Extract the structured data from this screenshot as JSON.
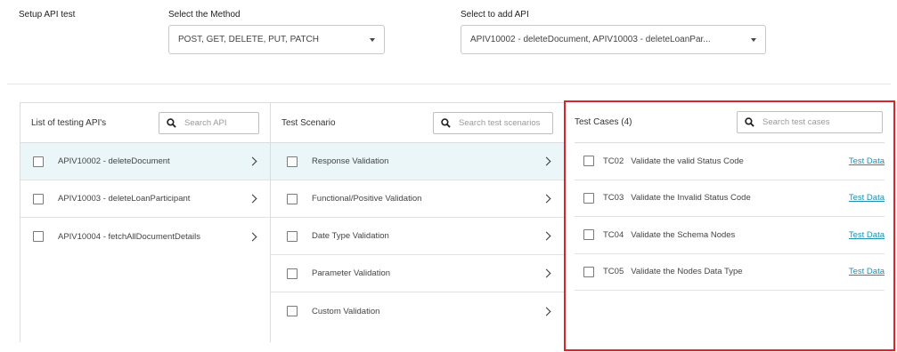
{
  "setup": {
    "title": "Setup API test",
    "method_label": "Select the Method",
    "method_value": "POST, GET, DELETE, PUT, PATCH",
    "api_label": "Select to add API",
    "api_value": "APIV10002 - deleteDocument, APIV10003 - deleteLoanPar..."
  },
  "apis_panel": {
    "title": "List of testing API's",
    "search_placeholder": "Search API",
    "items": [
      {
        "label": "APIV10002 - deleteDocument"
      },
      {
        "label": "APIV10003 - deleteLoanParticipant"
      },
      {
        "label": "APIV10004 - fetchAllDocumentDetails"
      }
    ]
  },
  "scenarios_panel": {
    "title": "Test Scenario",
    "search_placeholder": "Search test scenarios",
    "items": [
      {
        "label": "Response Validation"
      },
      {
        "label": "Functional/Positive Validation"
      },
      {
        "label": "Date Type Validation"
      },
      {
        "label": "Parameter Validation"
      },
      {
        "label": "Custom Validation"
      }
    ]
  },
  "cases_panel": {
    "title": "Test Cases (4)",
    "search_placeholder": "Search test cases",
    "link_label": "Test Data",
    "items": [
      {
        "id": "TC02",
        "label": "Validate the valid Status Code"
      },
      {
        "id": "TC03",
        "label": "Validate the Invalid Status Code"
      },
      {
        "id": "TC04",
        "label": "Validate the Schema Nodes"
      },
      {
        "id": "TC05",
        "label": "Validate the Nodes Data Type"
      }
    ]
  },
  "colors": {
    "highlight_border": "#d9252a",
    "active_row": "#eaf6f8",
    "link": "#1f8fb0"
  }
}
